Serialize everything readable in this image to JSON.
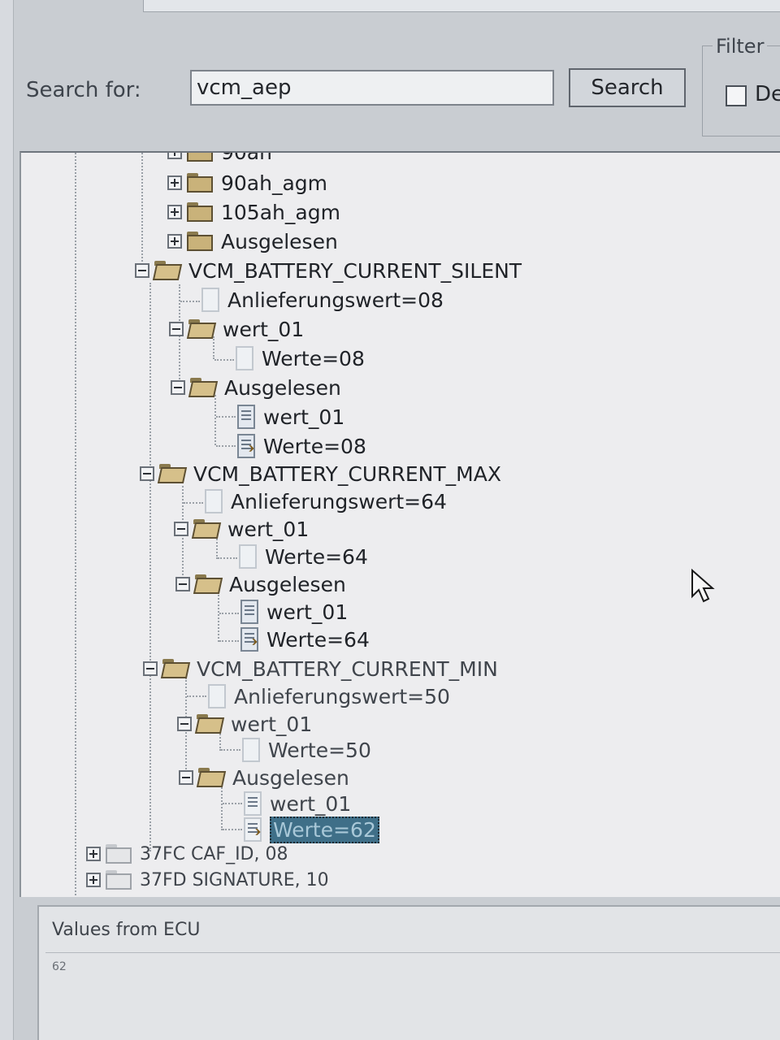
{
  "search": {
    "label": "Search for:",
    "value": "vcm_aep",
    "button": "Search"
  },
  "filter": {
    "title": "Filter",
    "option": "De",
    "checked": false
  },
  "tree": {
    "nodes": [
      {
        "label": "90ah"
      },
      {
        "label": "90ah_agm"
      },
      {
        "label": "105ah_agm"
      },
      {
        "label": "Ausgelesen"
      },
      {
        "label": "VCM_BATTERY_CURRENT_SILENT"
      },
      {
        "label": "Anlieferungswert=08"
      },
      {
        "label": "wert_01"
      },
      {
        "label": "Werte=08"
      },
      {
        "label": "Ausgelesen"
      },
      {
        "label": "wert_01"
      },
      {
        "label": "Werte=08"
      },
      {
        "label": "VCM_BATTERY_CURRENT_MAX"
      },
      {
        "label": "Anlieferungswert=64"
      },
      {
        "label": "wert_01"
      },
      {
        "label": "Werte=64"
      },
      {
        "label": "Ausgelesen"
      },
      {
        "label": "wert_01"
      },
      {
        "label": "Werte=64"
      },
      {
        "label": "VCM_BATTERY_CURRENT_MIN"
      },
      {
        "label": "Anlieferungswert=50"
      },
      {
        "label": "wert_01"
      },
      {
        "label": "Werte=50"
      },
      {
        "label": "Ausgelesen"
      },
      {
        "label": "wert_01"
      },
      {
        "label": "Werte=62",
        "selected": true
      },
      {
        "label": "37FC CAF_ID, 08"
      },
      {
        "label": "37FD SIGNATURE, 10"
      }
    ]
  },
  "values_panel": {
    "title": "Values from ECU",
    "content": "62"
  },
  "colors": {
    "selection": "#3f6f88",
    "panel": "#ededef",
    "window": "#c9cdd2"
  }
}
